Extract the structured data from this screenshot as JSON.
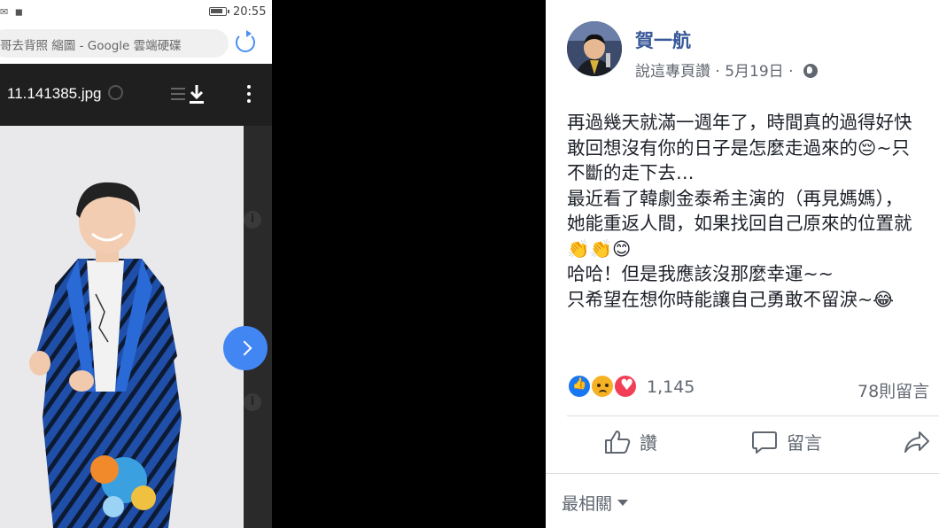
{
  "phone": {
    "status_bar": {
      "time": "20:55",
      "icons": "✉ ◼"
    },
    "url_bar": {
      "text": "哥去背照 縮圖 - Google 雲端硬碟"
    },
    "viewer": {
      "file_name": "11.141385.jpg"
    }
  },
  "post": {
    "author": "賀一航",
    "meta": {
      "page_link": "說這專頁讚",
      "date": "5月19日"
    },
    "body_lines": [
      "再過幾天就滿一週年了，時間真的過得好快",
      "敢回想沒有你的日子是怎麼走過來的😔~只",
      "不斷的走下去…",
      "最近看了韓劇金泰希主演的（再見媽媽），",
      "她能重返人間，如果找回自己原來的位置就",
      "👏👏😊",
      "哈哈！但是我應該沒那麼幸運~~",
      "只希望在想你時能讓自己勇敢不留淚~😂"
    ],
    "reactions": {
      "icons": [
        "like-icon",
        "sad-icon",
        "love-icon"
      ],
      "count": "1,145",
      "comments": "78則留言"
    },
    "actions": {
      "like": "讚",
      "comment": "留言",
      "share": "分"
    },
    "sort": {
      "label": "最相關"
    }
  }
}
